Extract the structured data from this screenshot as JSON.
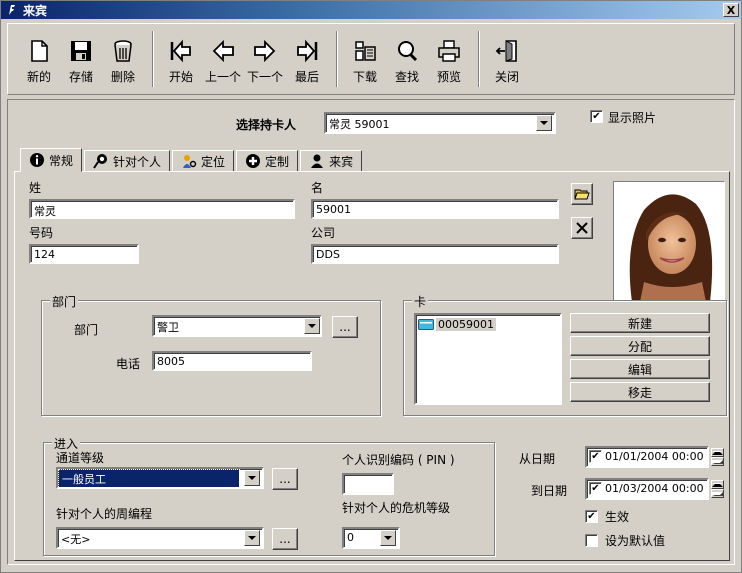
{
  "window": {
    "title": "来宾",
    "close_label": "X"
  },
  "toolbar": {
    "buttons": [
      {
        "label": "新的",
        "icon": "new-document-icon"
      },
      {
        "label": "存储",
        "icon": "floppy-disk-icon"
      },
      {
        "label": "删除",
        "icon": "trash-can-icon"
      },
      {
        "label": "开始",
        "icon": "first-record-icon"
      },
      {
        "label": "上一个",
        "icon": "arrow-left-icon"
      },
      {
        "label": "下一个",
        "icon": "arrow-right-icon"
      },
      {
        "label": "最后",
        "icon": "last-record-icon"
      },
      {
        "label": "下载",
        "icon": "download-icon"
      },
      {
        "label": "查找",
        "icon": "search-icon"
      },
      {
        "label": "预览",
        "icon": "printer-icon"
      },
      {
        "label": "关闭",
        "icon": "exit-door-icon"
      }
    ]
  },
  "cardholder": {
    "label": "选择持卡人",
    "value": "常灵 59001",
    "show_photo_label": "显示照片",
    "show_photo_checked": true
  },
  "tabs": [
    {
      "label": "常规",
      "icon": "info-icon",
      "active": true
    },
    {
      "label": "针对个人",
      "icon": "person-key-icon",
      "active": false
    },
    {
      "label": "定位",
      "icon": "locate-person-icon",
      "active": false
    },
    {
      "label": "定制",
      "icon": "plus-circle-icon",
      "active": false
    },
    {
      "label": "来宾",
      "icon": "guest-icon",
      "active": false
    }
  ],
  "general": {
    "last_name_label": "姓",
    "last_name": "常灵",
    "first_name_label": "名",
    "first_name": "59001",
    "number_label": "号码",
    "number": "124",
    "company_label": "公司",
    "company": "DDS"
  },
  "department": {
    "group_title": "部门",
    "dept_label": "部门",
    "dept_value": "警卫",
    "phone_label": "电话",
    "phone_value": "8005",
    "ellipsis": "..."
  },
  "card": {
    "group_title": "卡",
    "items": [
      "00059001"
    ],
    "buttons": [
      "新建",
      "分配",
      "编辑",
      "移走"
    ]
  },
  "access": {
    "group_title": "进入",
    "level_label": "通道等级",
    "level_value": "一般员工",
    "schedule_label": "针对个人的周编程",
    "schedule_value": "<无>",
    "pin_label": "个人识别编码 ( PIN )",
    "pin_value": "",
    "threat_label": "针对个人的危机等级",
    "threat_value": "0",
    "ellipsis": "..."
  },
  "dates": {
    "from_label": "从日期",
    "from_value": "01/01/2004 00:00",
    "to_label": "到日期",
    "to_value": "01/03/2004 00:00",
    "active_label": "生效",
    "active_checked": true,
    "default_label": "设为默认值",
    "default_checked": false
  }
}
